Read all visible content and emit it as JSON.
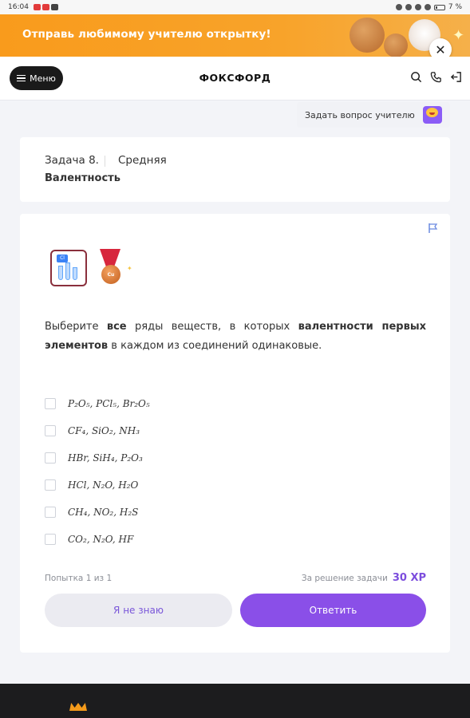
{
  "status_bar": {
    "time": "16:04",
    "battery": "7 %"
  },
  "banner": {
    "text": "Отправь любимому учителю открытку!",
    "close_icon": "close-icon",
    "bg_color": "#f99b1c"
  },
  "header": {
    "menu_label": "Меню",
    "logo": "ФОКСФОРД",
    "icons": [
      "search-icon",
      "phone-icon",
      "logout-icon"
    ]
  },
  "ask_teacher": {
    "label": "Задать вопрос учителю"
  },
  "task": {
    "number": "Задача 8.",
    "difficulty": "Средняя",
    "topic": "Валентность"
  },
  "question": {
    "text_parts": {
      "p1": "Выберите ",
      "p2": "все",
      "p3": " ряды веществ, в которых ",
      "p4": "валентности первых элементов",
      "p5": " в каждом из соединений одинаковые."
    },
    "options": [
      "P₂O₅, PCl₅, Br₂O₅",
      "CF₄, SiO₂, NH₃",
      "HBr, SiH₄, P₂O₃",
      "HCl, N₂O, H₂O",
      "CH₄, NO₂, H₂S",
      "CO₂, N₂O, HF"
    ]
  },
  "footer_bar": {
    "attempts": "Попытка 1 из 1",
    "reward_label": "За решение задачи",
    "reward_value": "30 XP",
    "dont_know_label": "Я не знаю",
    "answer_label": "Ответить"
  },
  "colors": {
    "accent": "#8a4fe8",
    "banner": "#f99b1c",
    "footer": "#1c1c1e"
  }
}
